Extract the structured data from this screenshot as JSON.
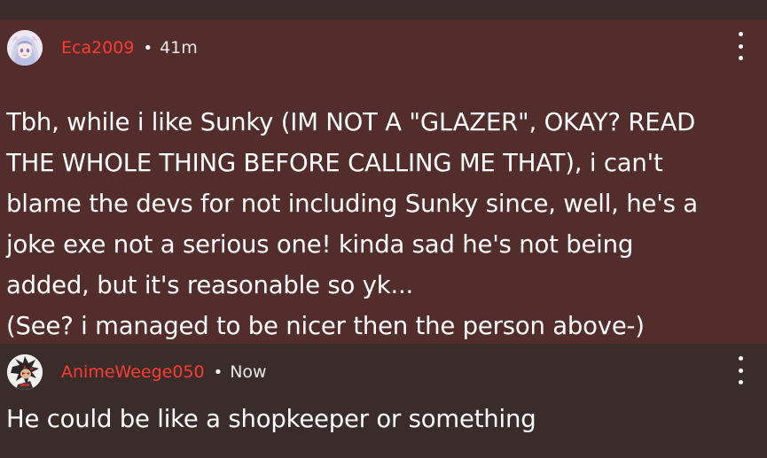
{
  "comments": [
    {
      "username": "Eca2009",
      "separator": "•",
      "time": "41m",
      "text": "Tbh, while i like Sunky (IM NOT A \"GLAZER\", OKAY? READ\nTHE WHOLE THING BEFORE CALLING ME THAT), i can't\nblame the devs for not including Sunky since, well, he's a\njoke exe not a serious one! kinda sad he's not being\nadded, but it's reasonable so yk...\n(See? i managed to be nicer then the person above-)",
      "avatar_icon": "anime-girl-avatar",
      "highlighted": true
    },
    {
      "username": "AnimeWeege050",
      "separator": "•",
      "time": "Now",
      "text": "He could be like a shopkeeper or something",
      "avatar_icon": "spiky-hedgehog-avatar",
      "highlighted": false
    }
  ],
  "colors": {
    "page_background": "#3b2c2c",
    "highlight_background": "#532c2c",
    "username": "#ff3b30",
    "text": "#ffffff"
  },
  "icons": {
    "menu": "kebab-menu-icon"
  }
}
